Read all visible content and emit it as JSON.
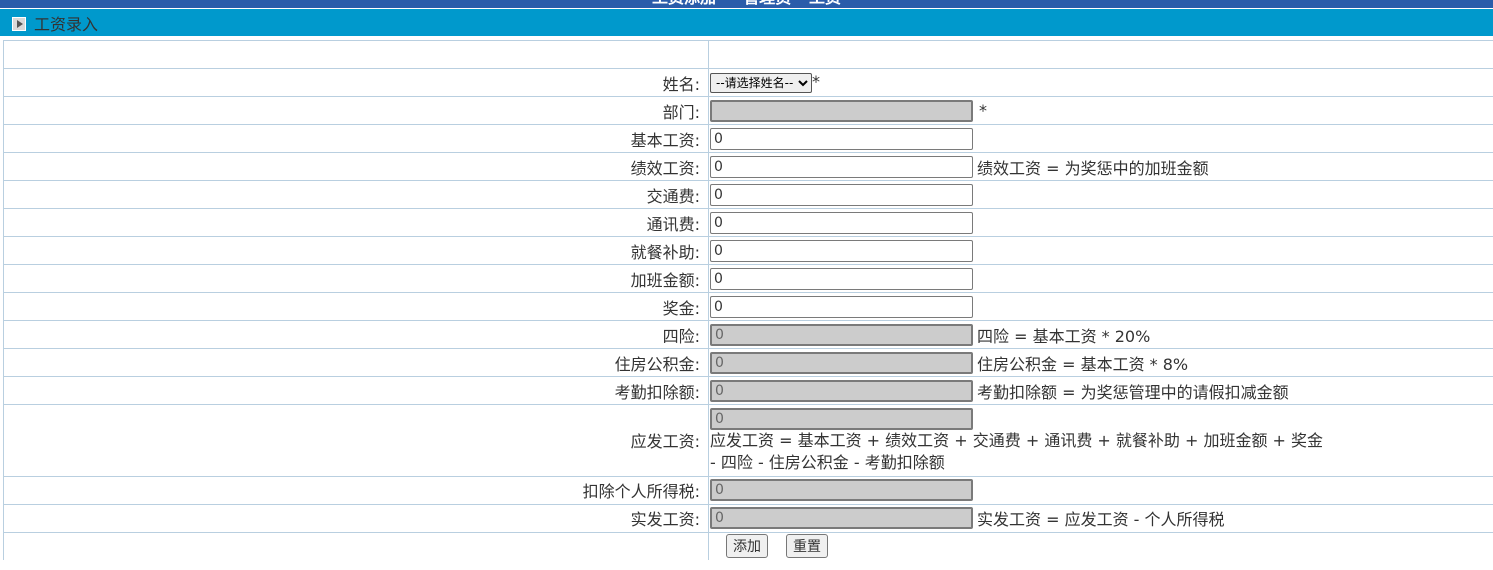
{
  "header": {
    "top_title": "工资添加 — 管理员 - 工资"
  },
  "panel": {
    "title": "工资录入"
  },
  "form": {
    "name": {
      "label": "姓名:",
      "selected": "--请选择姓名--",
      "required": "*"
    },
    "department": {
      "label": "部门:",
      "value": "",
      "required": "*"
    },
    "basic_salary": {
      "label": "基本工资:",
      "value": "0"
    },
    "performance_salary": {
      "label": "绩效工资:",
      "value": "0",
      "hint": "绩效工资 = 为奖惩中的加班金额"
    },
    "transport": {
      "label": "交通费:",
      "value": "0"
    },
    "communication": {
      "label": "通讯费:",
      "value": "0"
    },
    "meal": {
      "label": "就餐补助:",
      "value": "0"
    },
    "overtime": {
      "label": "加班金额:",
      "value": "0"
    },
    "bonus": {
      "label": "奖金:",
      "value": "0"
    },
    "insurance": {
      "label": "四险:",
      "value": "0",
      "hint": "四险 = 基本工资 * 20%"
    },
    "housing_fund": {
      "label": "住房公积金:",
      "value": "0",
      "hint": "住房公积金 = 基本工资 * 8%"
    },
    "attendance_deduction": {
      "label": "考勤扣除额:",
      "value": "0",
      "hint": "考勤扣除额 = 为奖惩管理中的请假扣减金额"
    },
    "gross_salary": {
      "label": "应发工资:",
      "value": "0",
      "hint_line1": "应发工资 = 基本工资 + 绩效工资 + 交通费 + 通讯费 + 就餐补助 + 加班金额 + 奖金",
      "hint_line2": "- 四险 - 住房公积金 - 考勤扣除额"
    },
    "income_tax": {
      "label": "扣除个人所得税:",
      "value": "0"
    },
    "net_salary": {
      "label": "实发工资:",
      "value": "0",
      "hint": "实发工资 = 应发工资 - 个人所得税"
    }
  },
  "buttons": {
    "add": "添加",
    "reset": "重置"
  }
}
